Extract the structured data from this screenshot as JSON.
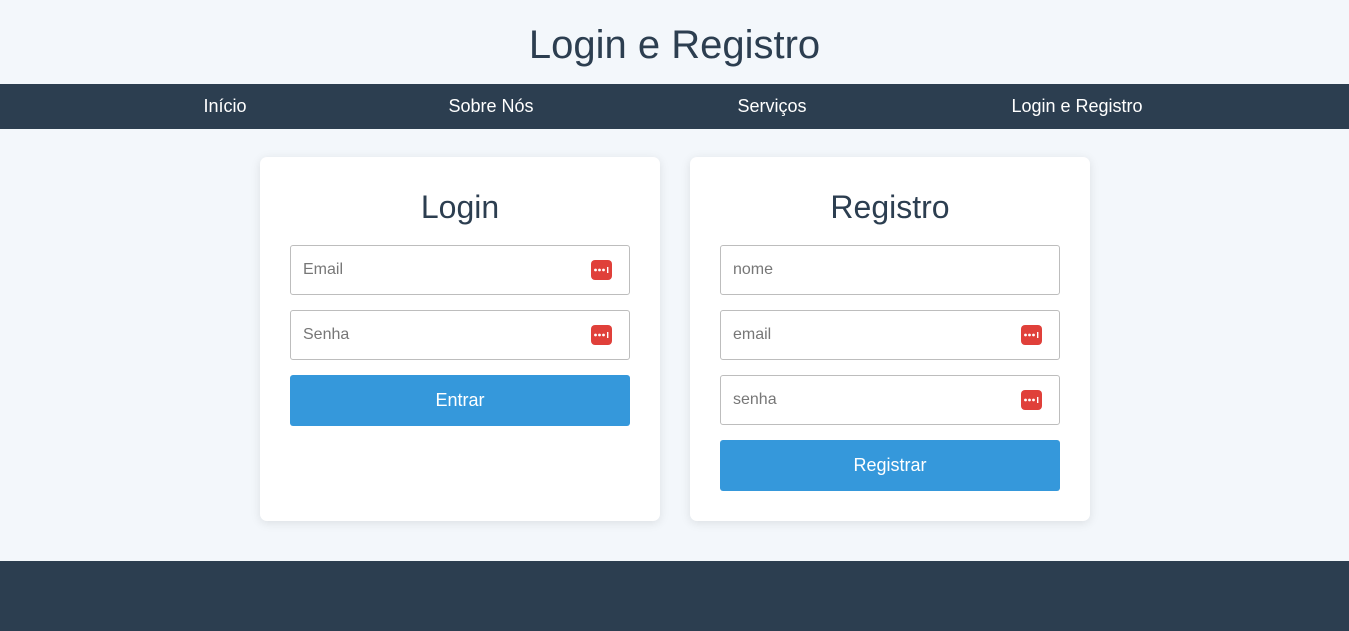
{
  "header": {
    "title": "Login e Registro"
  },
  "nav": {
    "items": [
      {
        "label": "Início"
      },
      {
        "label": "Sobre Nós"
      },
      {
        "label": "Serviços"
      },
      {
        "label": "Login e Registro"
      }
    ]
  },
  "login": {
    "title": "Login",
    "email_placeholder": "Email",
    "password_placeholder": "Senha",
    "submit_label": "Entrar"
  },
  "register": {
    "title": "Registro",
    "name_placeholder": "nome",
    "email_placeholder": "email",
    "password_placeholder": "senha",
    "submit_label": "Registrar"
  },
  "colors": {
    "primary": "#3598db",
    "dark": "#2c3e50",
    "background": "#f3f7fb",
    "password_manager_icon": "#e0403a"
  },
  "icons": {
    "password_manager": "password-manager-icon"
  }
}
